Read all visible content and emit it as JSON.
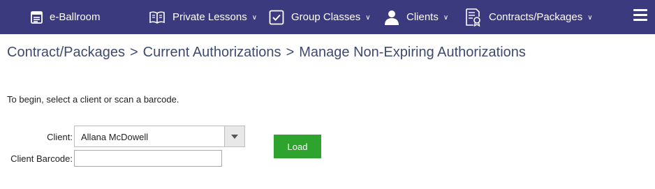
{
  "nav": {
    "brand": "e-Ballroom",
    "items": [
      {
        "label": "Private Lessons",
        "icon": "book-icon"
      },
      {
        "label": "Group Classes",
        "icon": "checkbox-icon"
      },
      {
        "label": "Clients",
        "icon": "user-icon"
      },
      {
        "label": "Contracts/Packages",
        "icon": "certificate-icon"
      }
    ],
    "caret": "∨"
  },
  "breadcrumb": {
    "items": [
      "Contract/Packages",
      "Current Authorizations",
      "Manage Non-Expiring Authorizations"
    ],
    "separator": ">"
  },
  "form": {
    "intro": "To begin, select a client or scan a barcode.",
    "client_label": "Client:",
    "client_value": "Allana McDowell",
    "barcode_label": "Client Barcode:",
    "barcode_value": "",
    "load_label": "Load"
  },
  "colors": {
    "navbar": "#3b3a7e",
    "breadcrumb": "#3e4a6e",
    "load_button": "#2ea42e"
  }
}
